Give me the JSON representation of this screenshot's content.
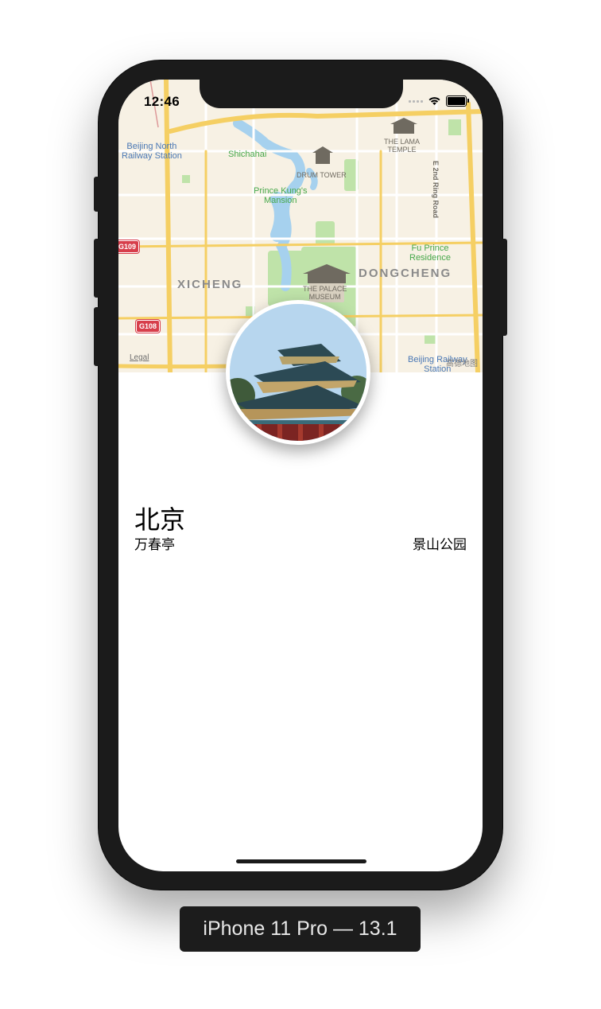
{
  "status_bar": {
    "time": "12:46"
  },
  "map": {
    "labels": {
      "beijing_north": "Beijing North\nRailway Station",
      "shichahai": "Shichahai",
      "drum_tower": "DRUM TOWER",
      "lama_temple": "THE LAMA\nTEMPLE",
      "ring_road": "E 2nd Ring Road",
      "prince_kung": "Prince Kung's\nMansion",
      "fu_prince": "Fu Prince\nResidence",
      "xicheng": "XICHENG",
      "dongcheng": "DONGCHENG",
      "palace_museum": "THE PALACE\nMUSEUM",
      "beijing_station": "Beijing Railway\nStation",
      "g109": "G109",
      "g108": "G108"
    },
    "legal": "Legal",
    "brand": "高德地图"
  },
  "content": {
    "title": "北京",
    "subtitle": "万春亭",
    "detail": "景山公园"
  },
  "simulator_label": "iPhone 11 Pro — 13.1"
}
